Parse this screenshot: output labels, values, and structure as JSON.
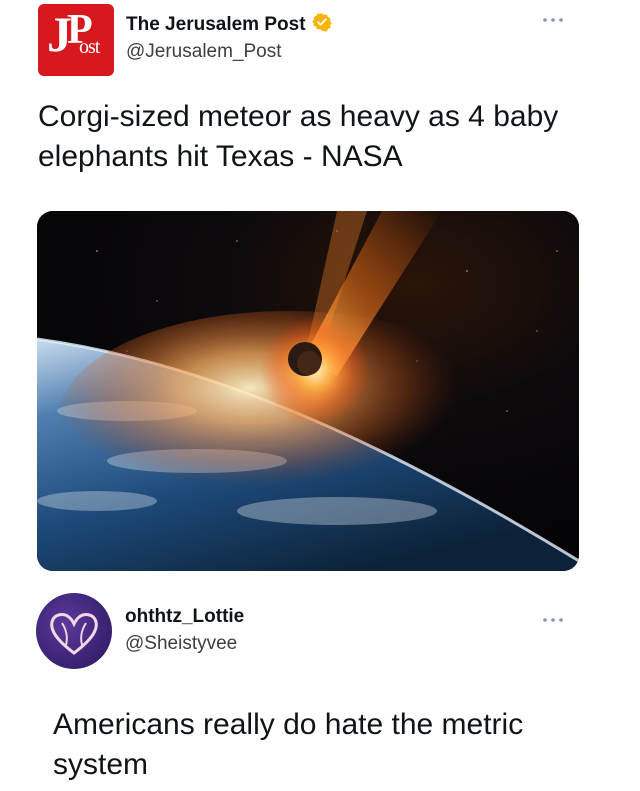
{
  "tweet1": {
    "display_name": "The Jerusalem Post",
    "verified": true,
    "verified_icon": "verified-badge-icon",
    "handle": "@Jerusalem_Post",
    "avatar_logo": "JPost",
    "more_icon": "more-options-icon",
    "text": "Corgi-sized meteor as heavy as 4 baby elephants hit Texas - NASA",
    "media_description": "meteor-striking-earth-image"
  },
  "tweet2": {
    "display_name": "ohthtz_Lottie",
    "handle": "@Sheistyvee",
    "avatar_icon": "heart-avatar-icon",
    "more_icon": "more-options-icon",
    "text": "Americans really do hate the metric system"
  },
  "colors": {
    "verified_badge": "#f4b400",
    "jpost_red": "#d7191f",
    "avatar_purple": "#3d2476",
    "text": "#0f1419",
    "handle": "#3a3f44"
  }
}
